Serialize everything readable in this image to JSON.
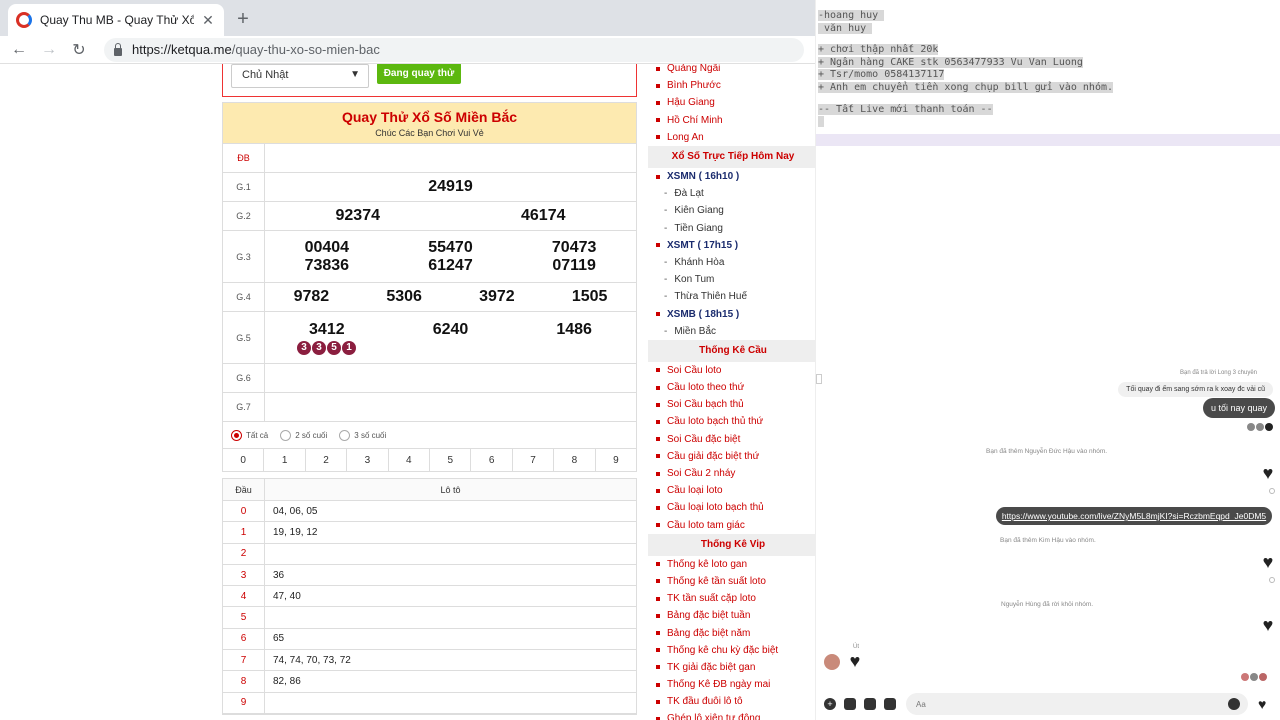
{
  "browser": {
    "tab_title": "Quay Thu MB - Quay Thử Xổ Số",
    "url_host": "https://ketqua.me",
    "url_path": "/quay-thu-xo-so-mien-bac"
  },
  "form": {
    "day_selected": "Chủ Nhật",
    "spin_label": "Đang quay thử"
  },
  "results": {
    "title": "Quay Thử Xổ Số Miền Bắc",
    "subtitle": "Chúc Các Bạn Chơi Vui Vẻ",
    "prizes": [
      {
        "label": "ĐB",
        "values": []
      },
      {
        "label": "G.1",
        "values": [
          "24919"
        ]
      },
      {
        "label": "G.2",
        "values": [
          "92374",
          "46174"
        ]
      },
      {
        "label": "G.3",
        "values": [
          "00404",
          "55470",
          "70473",
          "73836",
          "61247",
          "07119"
        ]
      },
      {
        "label": "G.4",
        "values": [
          "9782",
          "5306",
          "3972",
          "1505"
        ]
      },
      {
        "label": "G.5",
        "values": [
          "3412",
          "6240",
          "1486"
        ],
        "spinning": [
          "3",
          "3",
          "5",
          "1"
        ]
      },
      {
        "label": "G.6",
        "values": []
      },
      {
        "label": "G.7",
        "values": []
      }
    ],
    "radio_options": [
      "Tất cả",
      "2 số cuối",
      "3 số cuối"
    ]
  },
  "digits": [
    "0",
    "1",
    "2",
    "3",
    "4",
    "5",
    "6",
    "7",
    "8",
    "9"
  ],
  "loto": {
    "head_dau": "Đầu",
    "head_loto": "Lô tô",
    "rows": [
      {
        "dau": "0",
        "vals": "04, 06, 05"
      },
      {
        "dau": "1",
        "vals": "19, 19, 12"
      },
      {
        "dau": "2",
        "vals": ""
      },
      {
        "dau": "3",
        "vals": "36"
      },
      {
        "dau": "4",
        "vals": "47, 40"
      },
      {
        "dau": "5",
        "vals": ""
      },
      {
        "dau": "6",
        "vals": "65"
      },
      {
        "dau": "7",
        "vals": "74, 74, 70, 73, 72"
      },
      {
        "dau": "8",
        "vals": "82, 86"
      },
      {
        "dau": "9",
        "vals": ""
      }
    ]
  },
  "sidebar": [
    {
      "type": "link",
      "text": "Quảng Ngãi"
    },
    {
      "type": "link",
      "text": "Bình Phước"
    },
    {
      "type": "link",
      "text": "Hậu Giang"
    },
    {
      "type": "link",
      "text": "Hồ Chí Minh"
    },
    {
      "type": "link",
      "text": "Long An"
    },
    {
      "type": "head",
      "text": "Xổ Số Trực Tiếp Hôm Nay"
    },
    {
      "type": "bold",
      "text": "XSMN ( 16h10 )"
    },
    {
      "type": "sub",
      "text": "Đà Lạt"
    },
    {
      "type": "sub",
      "text": "Kiên Giang"
    },
    {
      "type": "sub",
      "text": "Tiền Giang"
    },
    {
      "type": "bold",
      "text": "XSMT ( 17h15 )"
    },
    {
      "type": "sub",
      "text": "Khánh Hòa"
    },
    {
      "type": "sub",
      "text": "Kon Tum"
    },
    {
      "type": "sub",
      "text": "Thừa Thiên Huế"
    },
    {
      "type": "bold",
      "text": "XSMB ( 18h15 )"
    },
    {
      "type": "sub",
      "text": "Miền Bắc"
    },
    {
      "type": "head",
      "text": "Thống Kê Cầu"
    },
    {
      "type": "link",
      "text": "Soi Cầu loto"
    },
    {
      "type": "link",
      "text": "Cầu loto theo thứ"
    },
    {
      "type": "link",
      "text": "Soi Cầu bạch thủ"
    },
    {
      "type": "link",
      "text": "Cầu loto bạch thủ thứ"
    },
    {
      "type": "link",
      "text": "Soi Cầu đặc biệt"
    },
    {
      "type": "link",
      "text": "Cầu giải đặc biệt thứ"
    },
    {
      "type": "link",
      "text": "Soi Cầu 2 nháy"
    },
    {
      "type": "link",
      "text": "Cầu loại loto"
    },
    {
      "type": "link",
      "text": "Cầu loại loto bạch thủ"
    },
    {
      "type": "link",
      "text": "Cầu loto tam giác"
    },
    {
      "type": "head",
      "text": "Thống Kê Vip"
    },
    {
      "type": "link",
      "text": "Thống kê loto gan"
    },
    {
      "type": "link",
      "text": "Thống kê tần suất loto"
    },
    {
      "type": "link",
      "text": "TK tần suất cặp loto"
    },
    {
      "type": "link",
      "text": "Bảng đặc biệt tuần"
    },
    {
      "type": "link",
      "text": "Bảng đặc biệt năm"
    },
    {
      "type": "link",
      "text": "Thống kê chu kỳ đặc biệt"
    },
    {
      "type": "link",
      "text": "TK giải đặc biệt gan"
    },
    {
      "type": "link",
      "text": "Thống Kê ĐB ngày mai"
    },
    {
      "type": "link",
      "text": "TK đầu đuôi lô tô"
    },
    {
      "type": "link",
      "text": "Ghép lô xiên tự động"
    }
  ],
  "overlay_lines": [
    "-hoang huy ",
    " văn huy ",
    "",
    "+ chơi thập nhất 20k",
    "+ Ngân hàng CAKE stk 0563477933 Vu Van Luong",
    "+ Tsr/momo 0584137117",
    "+ Anh em chuyển tiền xong chụp bill gửi vào nhóm.",
    "",
    "-- Tất Live mới thanh toán --",
    " "
  ],
  "chat": {
    "reply_note": "Bạn đã trả lời Long 3 chuyên",
    "grey_msg": "Tối quay đi ếm sang sớm ra k xoay đc vải cũ",
    "dark_msg": "u tối nay quay",
    "sys1": "Bạn đã thêm Nguyễn Đức Hậu vào nhóm.",
    "link": "https://www.youtube.com/live/ZNyM5L8mjKI?si=RczbmEqpd_Je0DM5",
    "sys2": "Bạn đã thêm Kim Hậu vào nhóm.",
    "sys3": "Nguyễn Hùng đã rời khỏi nhóm.",
    "sender": "Út",
    "input_placeholder": "Aa"
  }
}
